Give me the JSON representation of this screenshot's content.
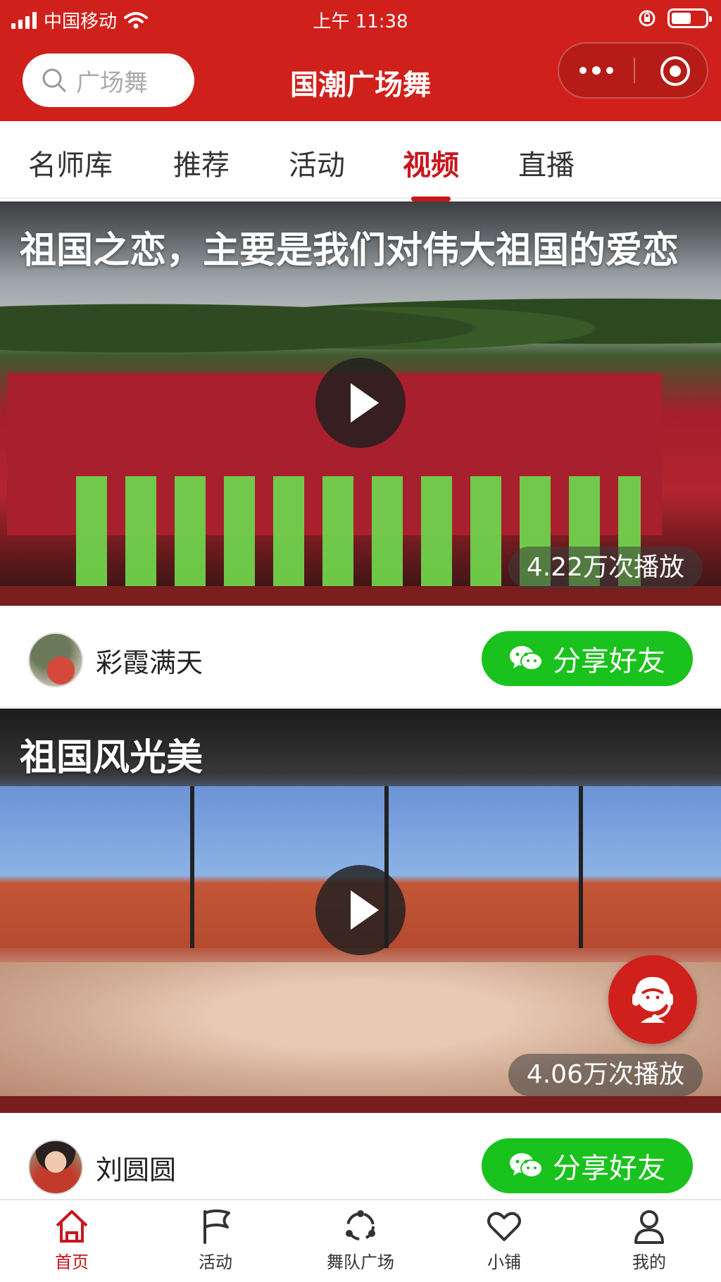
{
  "status_bar": {
    "carrier": "中国移动",
    "time": "上午 11:38"
  },
  "nav": {
    "search_placeholder": "广场舞",
    "title": "国潮广场舞"
  },
  "tabs": [
    {
      "label": "名师库",
      "active": false
    },
    {
      "label": "推荐",
      "active": false
    },
    {
      "label": "活动",
      "active": false
    },
    {
      "label": "视频",
      "active": true
    },
    {
      "label": "直播",
      "active": false
    }
  ],
  "videos": [
    {
      "title": "祖国之恋，主要是我们对伟大祖国的爱恋",
      "views": "4.22万次播放",
      "author": "彩霞满天",
      "share_label": "分享好友"
    },
    {
      "title": "祖国风光美",
      "views": "4.06万次播放",
      "author": "刘圆圆",
      "share_label": "分享好友"
    }
  ],
  "tabbar": [
    {
      "label": "首页",
      "icon": "home-icon",
      "active": true
    },
    {
      "label": "活动",
      "icon": "flag-icon",
      "active": false
    },
    {
      "label": "舞队广场",
      "icon": "team-icon",
      "active": false
    },
    {
      "label": "小铺",
      "icon": "heart-icon",
      "active": false
    },
    {
      "label": "我的",
      "icon": "user-icon",
      "active": false
    }
  ],
  "colors": {
    "brand_red": "#d0201b",
    "active_tab": "#c8161d",
    "share_green": "#19c21c"
  }
}
